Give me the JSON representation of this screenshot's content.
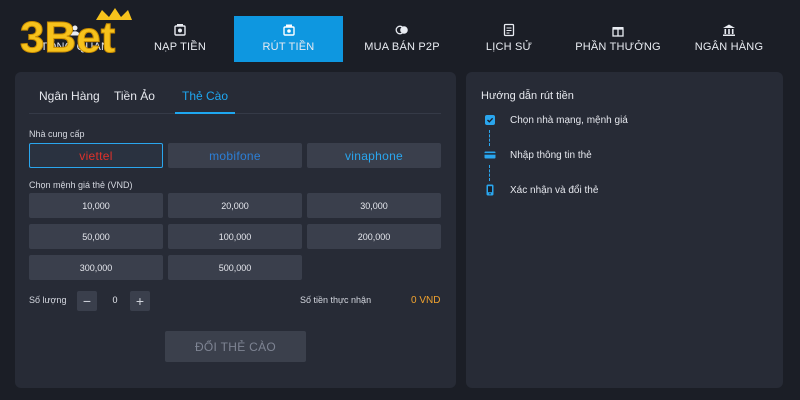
{
  "brand": {
    "logo_text": "3Bet",
    "accent": "#0e97e0",
    "logo_yellow": "#f6c21c"
  },
  "nav": {
    "items": [
      {
        "label": "TỔNG QUAN",
        "icon": "user-icon"
      },
      {
        "label": "NẠP TIỀN",
        "icon": "deposit-icon"
      },
      {
        "label": "RÚT TIỀN",
        "icon": "withdraw-icon",
        "active": true
      },
      {
        "label": "MUA BÁN P2P",
        "icon": "coins-icon"
      },
      {
        "label": "LỊCH SỬ",
        "icon": "history-icon"
      },
      {
        "label": "PHẦN THƯỞNG",
        "icon": "reward-icon"
      },
      {
        "label": "NGÂN HÀNG",
        "icon": "bank-icon"
      }
    ]
  },
  "withdraw": {
    "tabs": [
      {
        "label": "Ngân Hàng"
      },
      {
        "label": "Tiền Ảo"
      },
      {
        "label": "Thẻ Cào",
        "active": true
      }
    ],
    "provider_label": "Nhà cung cấp",
    "providers": [
      {
        "name": "viettel",
        "selected": true
      },
      {
        "name": "mobifone"
      },
      {
        "name": "vinaphone"
      }
    ],
    "denomination_label": "Chọn mệnh giá thẻ (VND)",
    "denominations": [
      "10,000",
      "20,000",
      "30,000",
      "50,000",
      "100,000",
      "200,000",
      "300,000",
      "500,000"
    ],
    "quantity_label": "Số lượng",
    "quantity_value": "0",
    "minus_symbol": "−",
    "plus_symbol": "+",
    "receive_label": "Số tiền thực nhận",
    "receive_value": "0 VND",
    "submit_label": "ĐỔI THẺ CÀO"
  },
  "guide": {
    "title": "Hướng dẫn rút tiền",
    "steps": [
      {
        "text": "Chọn nhà mạng, mệnh giá",
        "icon": "check-card-icon"
      },
      {
        "text": "Nhập thông tin thẻ",
        "icon": "card-icon"
      },
      {
        "text": "Xác nhận và đổi thẻ",
        "icon": "phone-icon"
      }
    ]
  }
}
